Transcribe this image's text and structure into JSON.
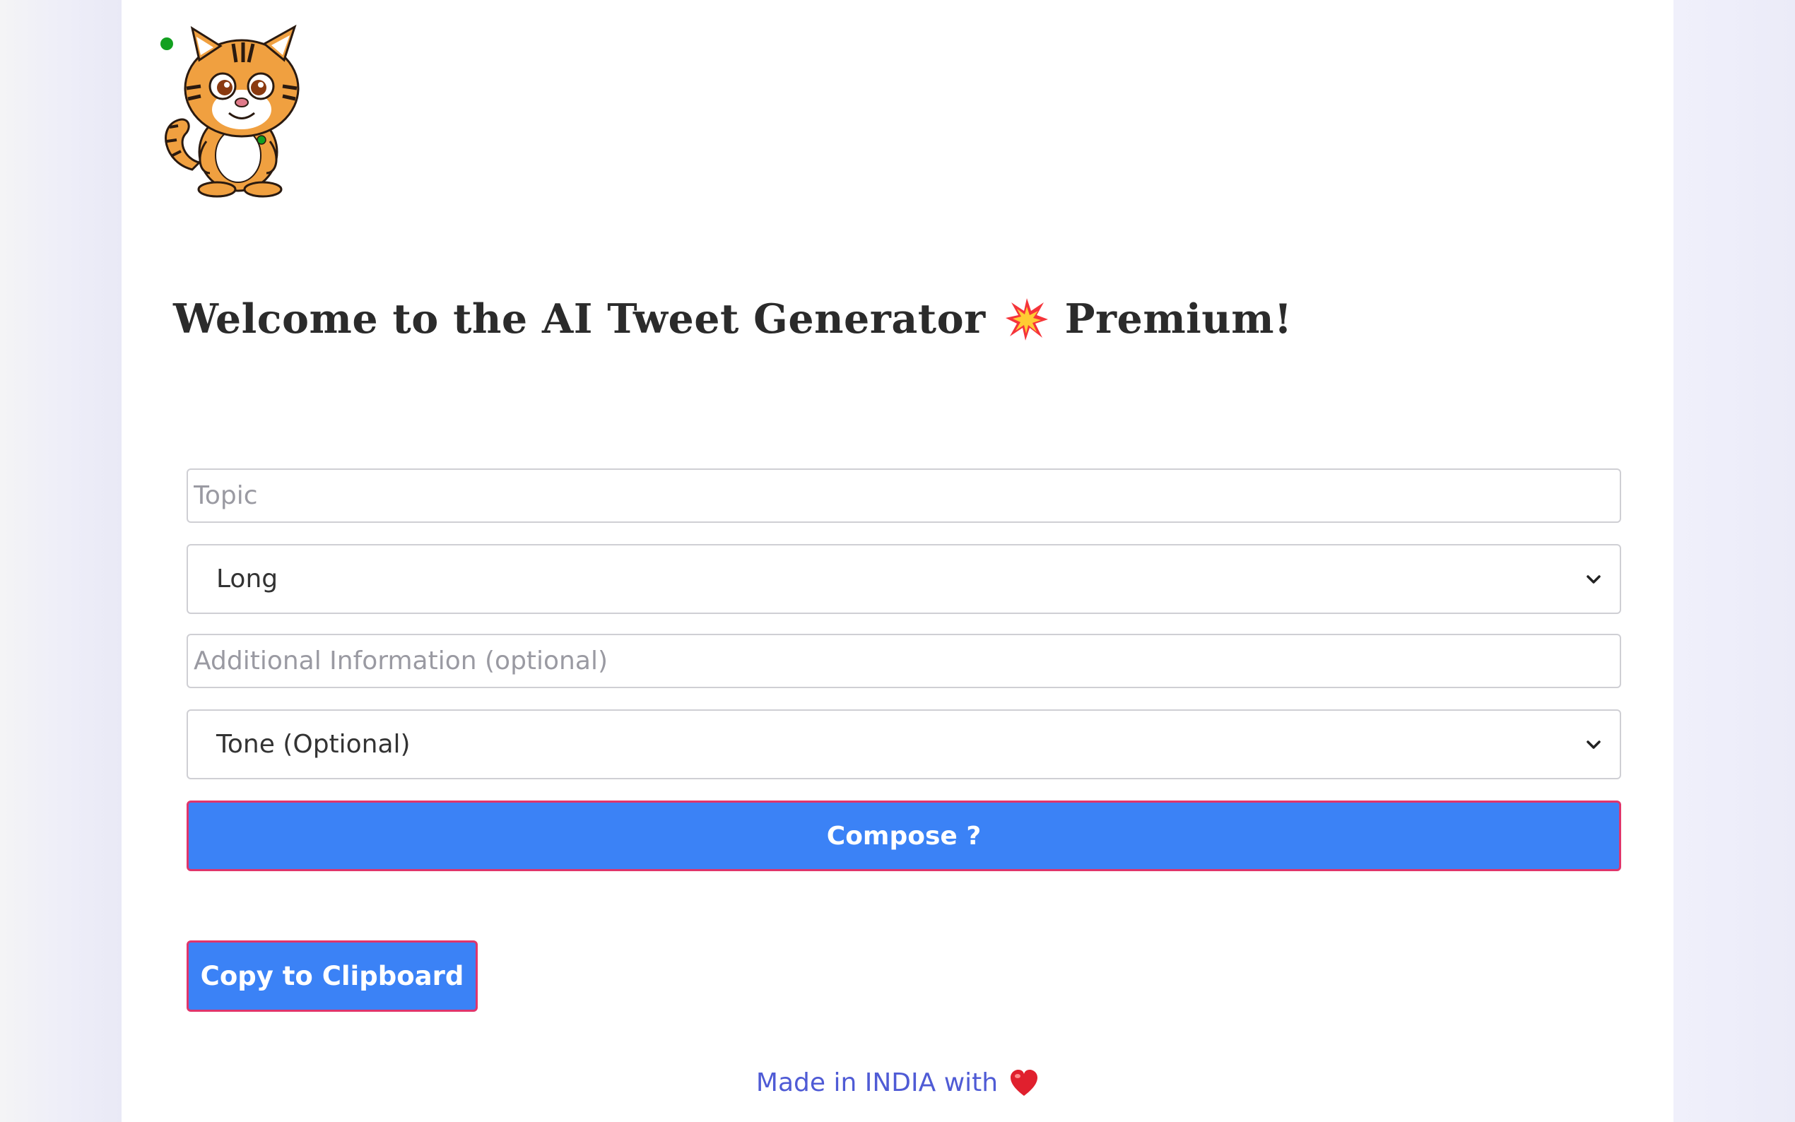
{
  "header": {
    "logo_icon": "tiger-mascot-icon",
    "title_text": "Welcome to the AI Tweet Generator",
    "title_emoji": "collision-burst-icon",
    "title_suffix": "Premium!"
  },
  "form": {
    "topic": {
      "value": "",
      "placeholder": "Topic"
    },
    "length_select": {
      "selected": "Long"
    },
    "additional_info": {
      "value": "",
      "placeholder": "Additional Information (optional)"
    },
    "tone_select": {
      "selected": "Tone (Optional)"
    },
    "compose_label": "Compose ?"
  },
  "actions": {
    "copy_label": "Copy to Clipboard"
  },
  "footer": {
    "text": "Made in INDIA with",
    "heart_icon": "heart-icon"
  },
  "colors": {
    "accent": "#3b82f6",
    "button_border": "#e0356b",
    "footer_text": "#4f5bd5",
    "title_text": "#2b2b2b"
  }
}
